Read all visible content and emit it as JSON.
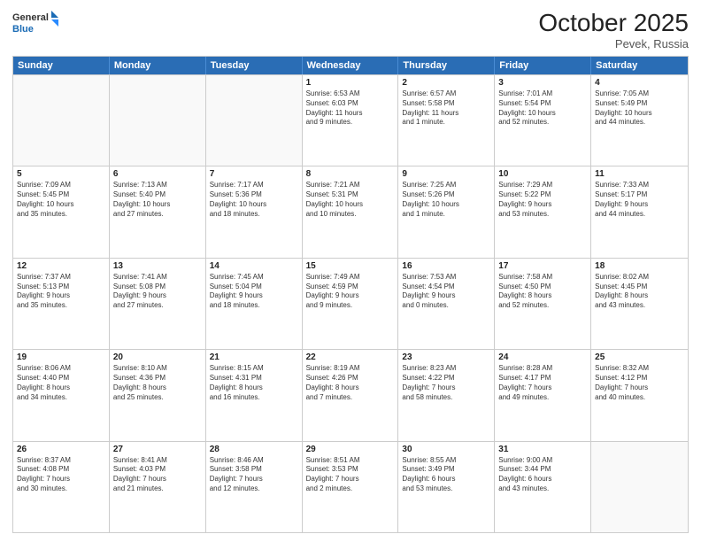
{
  "header": {
    "logo_line1": "General",
    "logo_line2": "Blue",
    "month_title": "October 2025",
    "location": "Pevek, Russia"
  },
  "weekdays": [
    "Sunday",
    "Monday",
    "Tuesday",
    "Wednesday",
    "Thursday",
    "Friday",
    "Saturday"
  ],
  "weeks": [
    [
      {
        "day": "",
        "info": "",
        "empty": true
      },
      {
        "day": "",
        "info": "",
        "empty": true
      },
      {
        "day": "",
        "info": "",
        "empty": true
      },
      {
        "day": "1",
        "info": "Sunrise: 6:53 AM\nSunset: 6:03 PM\nDaylight: 11 hours\nand 9 minutes."
      },
      {
        "day": "2",
        "info": "Sunrise: 6:57 AM\nSunset: 5:58 PM\nDaylight: 11 hours\nand 1 minute."
      },
      {
        "day": "3",
        "info": "Sunrise: 7:01 AM\nSunset: 5:54 PM\nDaylight: 10 hours\nand 52 minutes."
      },
      {
        "day": "4",
        "info": "Sunrise: 7:05 AM\nSunset: 5:49 PM\nDaylight: 10 hours\nand 44 minutes."
      }
    ],
    [
      {
        "day": "5",
        "info": "Sunrise: 7:09 AM\nSunset: 5:45 PM\nDaylight: 10 hours\nand 35 minutes."
      },
      {
        "day": "6",
        "info": "Sunrise: 7:13 AM\nSunset: 5:40 PM\nDaylight: 10 hours\nand 27 minutes."
      },
      {
        "day": "7",
        "info": "Sunrise: 7:17 AM\nSunset: 5:36 PM\nDaylight: 10 hours\nand 18 minutes."
      },
      {
        "day": "8",
        "info": "Sunrise: 7:21 AM\nSunset: 5:31 PM\nDaylight: 10 hours\nand 10 minutes."
      },
      {
        "day": "9",
        "info": "Sunrise: 7:25 AM\nSunset: 5:26 PM\nDaylight: 10 hours\nand 1 minute."
      },
      {
        "day": "10",
        "info": "Sunrise: 7:29 AM\nSunset: 5:22 PM\nDaylight: 9 hours\nand 53 minutes."
      },
      {
        "day": "11",
        "info": "Sunrise: 7:33 AM\nSunset: 5:17 PM\nDaylight: 9 hours\nand 44 minutes."
      }
    ],
    [
      {
        "day": "12",
        "info": "Sunrise: 7:37 AM\nSunset: 5:13 PM\nDaylight: 9 hours\nand 35 minutes."
      },
      {
        "day": "13",
        "info": "Sunrise: 7:41 AM\nSunset: 5:08 PM\nDaylight: 9 hours\nand 27 minutes."
      },
      {
        "day": "14",
        "info": "Sunrise: 7:45 AM\nSunset: 5:04 PM\nDaylight: 9 hours\nand 18 minutes."
      },
      {
        "day": "15",
        "info": "Sunrise: 7:49 AM\nSunset: 4:59 PM\nDaylight: 9 hours\nand 9 minutes."
      },
      {
        "day": "16",
        "info": "Sunrise: 7:53 AM\nSunset: 4:54 PM\nDaylight: 9 hours\nand 0 minutes."
      },
      {
        "day": "17",
        "info": "Sunrise: 7:58 AM\nSunset: 4:50 PM\nDaylight: 8 hours\nand 52 minutes."
      },
      {
        "day": "18",
        "info": "Sunrise: 8:02 AM\nSunset: 4:45 PM\nDaylight: 8 hours\nand 43 minutes."
      }
    ],
    [
      {
        "day": "19",
        "info": "Sunrise: 8:06 AM\nSunset: 4:40 PM\nDaylight: 8 hours\nand 34 minutes."
      },
      {
        "day": "20",
        "info": "Sunrise: 8:10 AM\nSunset: 4:36 PM\nDaylight: 8 hours\nand 25 minutes."
      },
      {
        "day": "21",
        "info": "Sunrise: 8:15 AM\nSunset: 4:31 PM\nDaylight: 8 hours\nand 16 minutes."
      },
      {
        "day": "22",
        "info": "Sunrise: 8:19 AM\nSunset: 4:26 PM\nDaylight: 8 hours\nand 7 minutes."
      },
      {
        "day": "23",
        "info": "Sunrise: 8:23 AM\nSunset: 4:22 PM\nDaylight: 7 hours\nand 58 minutes."
      },
      {
        "day": "24",
        "info": "Sunrise: 8:28 AM\nSunset: 4:17 PM\nDaylight: 7 hours\nand 49 minutes."
      },
      {
        "day": "25",
        "info": "Sunrise: 8:32 AM\nSunset: 4:12 PM\nDaylight: 7 hours\nand 40 minutes."
      }
    ],
    [
      {
        "day": "26",
        "info": "Sunrise: 8:37 AM\nSunset: 4:08 PM\nDaylight: 7 hours\nand 30 minutes."
      },
      {
        "day": "27",
        "info": "Sunrise: 8:41 AM\nSunset: 4:03 PM\nDaylight: 7 hours\nand 21 minutes."
      },
      {
        "day": "28",
        "info": "Sunrise: 8:46 AM\nSunset: 3:58 PM\nDaylight: 7 hours\nand 12 minutes."
      },
      {
        "day": "29",
        "info": "Sunrise: 8:51 AM\nSunset: 3:53 PM\nDaylight: 7 hours\nand 2 minutes."
      },
      {
        "day": "30",
        "info": "Sunrise: 8:55 AM\nSunset: 3:49 PM\nDaylight: 6 hours\nand 53 minutes."
      },
      {
        "day": "31",
        "info": "Sunrise: 9:00 AM\nSunset: 3:44 PM\nDaylight: 6 hours\nand 43 minutes."
      },
      {
        "day": "",
        "info": "",
        "empty": true
      }
    ]
  ]
}
